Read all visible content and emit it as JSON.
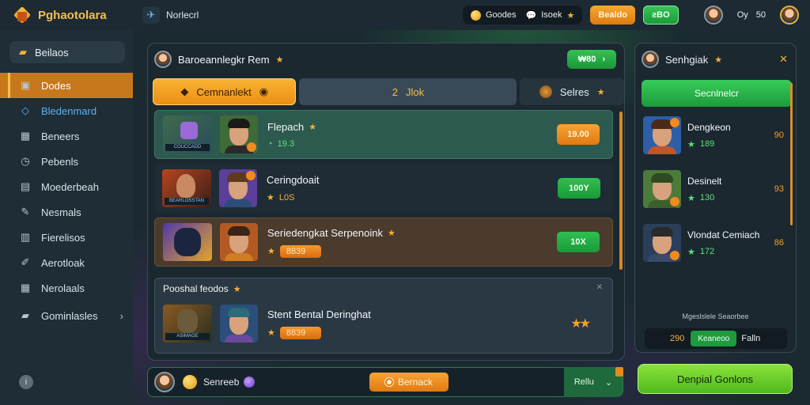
{
  "app": {
    "brand": "Pghaotolara",
    "tab_label": "Norlecrl"
  },
  "topbar": {
    "pill_a": "Goodes",
    "pill_b": "Isoek",
    "chip_orange": "Bealdo",
    "chip_green": "ƨBO",
    "counter": "Oy",
    "counter_n": "50"
  },
  "sidebar": {
    "header": "Beilaos",
    "items": [
      {
        "label": "Dodes",
        "icon": "box-icon"
      },
      {
        "label": "Bledenmard",
        "icon": "diamond-icon"
      },
      {
        "label": "Beneers",
        "icon": "grid-icon"
      },
      {
        "label": "Pebenls",
        "icon": "clock-icon"
      },
      {
        "label": "Moederbeah",
        "icon": "window-icon"
      },
      {
        "label": "Nesmals",
        "icon": "pencil-icon"
      },
      {
        "label": "Fierelisos",
        "icon": "chart-icon"
      },
      {
        "label": "Aerotloak",
        "icon": "edit-icon"
      },
      {
        "label": "Nerolaals",
        "icon": "table-icon"
      },
      {
        "label": "Gominlasles",
        "icon": "folder-icon"
      }
    ]
  },
  "main": {
    "title": "Baroeannlegkr Rem",
    "header_button": "₩80",
    "tabs": [
      {
        "label": "Cemnanlekt"
      },
      {
        "label": "Jlok",
        "prefix": "2"
      },
      {
        "label": "Selres"
      }
    ],
    "rows": [
      {
        "name": "Flepach",
        "sub": "19.3",
        "thumb_caption": "COUCCADD",
        "action": "19.00"
      },
      {
        "name": "Ceringdoait",
        "sub": "L0S",
        "thumb_caption": "BEARLOSSTAN",
        "action": "100Y"
      },
      {
        "name": "Seriedengkat Serpenoink",
        "sub": "8839",
        "thumb_caption": "",
        "action": "10X"
      }
    ],
    "section": {
      "title": "Pooshal feodos",
      "row": {
        "name": "Stent Bental Deringhat",
        "sub": "8839",
        "thumb_caption": "ASIMAGE"
      }
    }
  },
  "bottombar": {
    "label": "Senreeb",
    "button": "Bernack",
    "select": "Rellu"
  },
  "right_panel": {
    "title": "Senhgiak",
    "button": "Secnlnelcr",
    "items": [
      {
        "name": "Dengkeon",
        "sub": "189",
        "value": "90"
      },
      {
        "name": "Desinelt",
        "sub": "130",
        "value": "93"
      },
      {
        "name": "Vlondat Cemiach",
        "sub": "172",
        "value": "86"
      }
    ],
    "caption": "Mgeslslele Seaorbee",
    "footer_num": "290",
    "footer_mid": "Keaneoo",
    "footer_label": "Falln"
  },
  "cta": {
    "label": "Denpial Gonlons"
  }
}
